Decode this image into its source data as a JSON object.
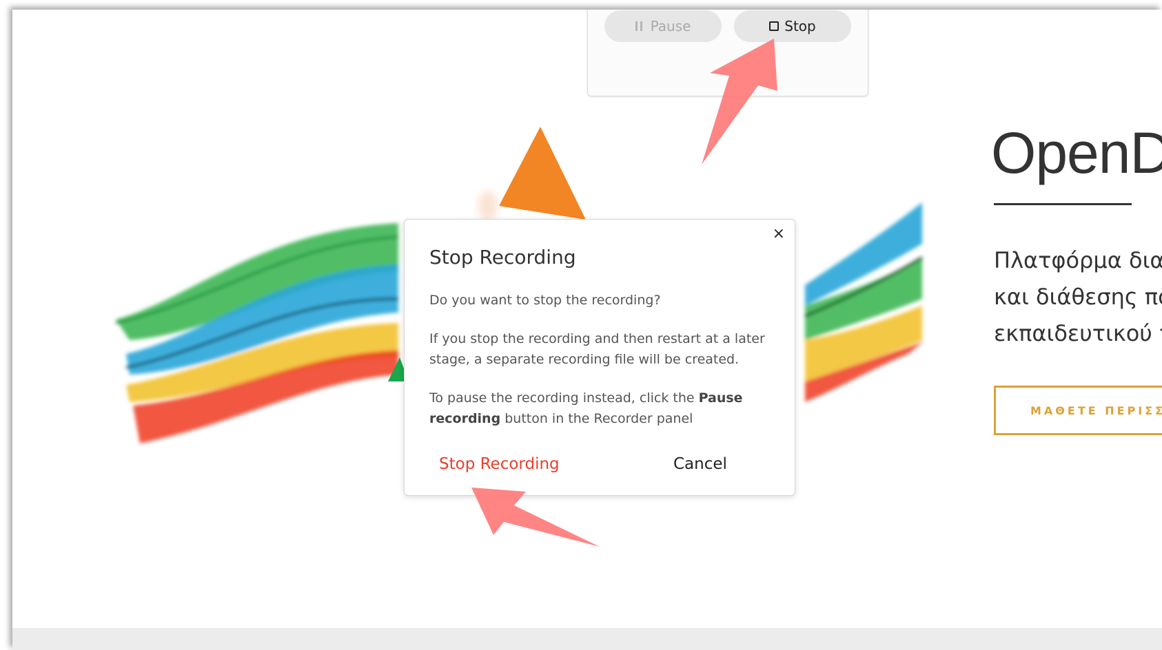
{
  "recorder": {
    "pause_label": "Pause",
    "stop_label": "Stop"
  },
  "site": {
    "title": "OpenD",
    "subtitle_lines": [
      "Πλατφόρμα δια",
      "και διάθεσης πο",
      "εκπαιδευτικού τ"
    ],
    "learn_more_label": "ΜΑΘΕΤΕ ΠΕΡΙΣΣ"
  },
  "dialog": {
    "close_glyph": "×",
    "title": "Stop Recording",
    "question": "Do you want to stop the recording?",
    "paragraph1": "If you stop the recording and then restart at a later stage, a separate recording file will be created.",
    "paragraph2_before": "To pause the recording instead, click the ",
    "paragraph2_bold": "Pause recording",
    "paragraph2_after": " button in the Recorder panel",
    "stop_button_label": "Stop Recording",
    "cancel_button_label": "Cancel"
  },
  "colors": {
    "stop_recording_red": "#e8402c",
    "learn_more_gold": "#e0a033",
    "annotation_arrow": "#ff7b7b",
    "logo_orange": "#f28524",
    "logo_green": "#1aa84a"
  },
  "icons": {
    "pause": "pause-icon",
    "stop": "stop-square-icon",
    "close": "close-icon"
  }
}
